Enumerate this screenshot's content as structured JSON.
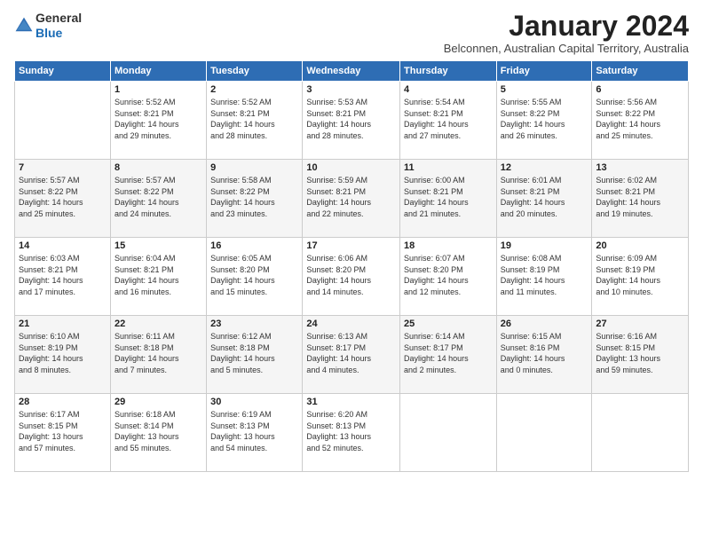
{
  "logo": {
    "line1": "General",
    "line2": "Blue"
  },
  "title": "January 2024",
  "subtitle": "Belconnen, Australian Capital Territory, Australia",
  "weekdays": [
    "Sunday",
    "Monday",
    "Tuesday",
    "Wednesday",
    "Thursday",
    "Friday",
    "Saturday"
  ],
  "weeks": [
    [
      {
        "day": "",
        "info": ""
      },
      {
        "day": "1",
        "info": "Sunrise: 5:52 AM\nSunset: 8:21 PM\nDaylight: 14 hours\nand 29 minutes."
      },
      {
        "day": "2",
        "info": "Sunrise: 5:52 AM\nSunset: 8:21 PM\nDaylight: 14 hours\nand 28 minutes."
      },
      {
        "day": "3",
        "info": "Sunrise: 5:53 AM\nSunset: 8:21 PM\nDaylight: 14 hours\nand 28 minutes."
      },
      {
        "day": "4",
        "info": "Sunrise: 5:54 AM\nSunset: 8:21 PM\nDaylight: 14 hours\nand 27 minutes."
      },
      {
        "day": "5",
        "info": "Sunrise: 5:55 AM\nSunset: 8:22 PM\nDaylight: 14 hours\nand 26 minutes."
      },
      {
        "day": "6",
        "info": "Sunrise: 5:56 AM\nSunset: 8:22 PM\nDaylight: 14 hours\nand 25 minutes."
      }
    ],
    [
      {
        "day": "7",
        "info": "Sunrise: 5:57 AM\nSunset: 8:22 PM\nDaylight: 14 hours\nand 25 minutes."
      },
      {
        "day": "8",
        "info": "Sunrise: 5:57 AM\nSunset: 8:22 PM\nDaylight: 14 hours\nand 24 minutes."
      },
      {
        "day": "9",
        "info": "Sunrise: 5:58 AM\nSunset: 8:22 PM\nDaylight: 14 hours\nand 23 minutes."
      },
      {
        "day": "10",
        "info": "Sunrise: 5:59 AM\nSunset: 8:21 PM\nDaylight: 14 hours\nand 22 minutes."
      },
      {
        "day": "11",
        "info": "Sunrise: 6:00 AM\nSunset: 8:21 PM\nDaylight: 14 hours\nand 21 minutes."
      },
      {
        "day": "12",
        "info": "Sunrise: 6:01 AM\nSunset: 8:21 PM\nDaylight: 14 hours\nand 20 minutes."
      },
      {
        "day": "13",
        "info": "Sunrise: 6:02 AM\nSunset: 8:21 PM\nDaylight: 14 hours\nand 19 minutes."
      }
    ],
    [
      {
        "day": "14",
        "info": "Sunrise: 6:03 AM\nSunset: 8:21 PM\nDaylight: 14 hours\nand 17 minutes."
      },
      {
        "day": "15",
        "info": "Sunrise: 6:04 AM\nSunset: 8:21 PM\nDaylight: 14 hours\nand 16 minutes."
      },
      {
        "day": "16",
        "info": "Sunrise: 6:05 AM\nSunset: 8:20 PM\nDaylight: 14 hours\nand 15 minutes."
      },
      {
        "day": "17",
        "info": "Sunrise: 6:06 AM\nSunset: 8:20 PM\nDaylight: 14 hours\nand 14 minutes."
      },
      {
        "day": "18",
        "info": "Sunrise: 6:07 AM\nSunset: 8:20 PM\nDaylight: 14 hours\nand 12 minutes."
      },
      {
        "day": "19",
        "info": "Sunrise: 6:08 AM\nSunset: 8:19 PM\nDaylight: 14 hours\nand 11 minutes."
      },
      {
        "day": "20",
        "info": "Sunrise: 6:09 AM\nSunset: 8:19 PM\nDaylight: 14 hours\nand 10 minutes."
      }
    ],
    [
      {
        "day": "21",
        "info": "Sunrise: 6:10 AM\nSunset: 8:19 PM\nDaylight: 14 hours\nand 8 minutes."
      },
      {
        "day": "22",
        "info": "Sunrise: 6:11 AM\nSunset: 8:18 PM\nDaylight: 14 hours\nand 7 minutes."
      },
      {
        "day": "23",
        "info": "Sunrise: 6:12 AM\nSunset: 8:18 PM\nDaylight: 14 hours\nand 5 minutes."
      },
      {
        "day": "24",
        "info": "Sunrise: 6:13 AM\nSunset: 8:17 PM\nDaylight: 14 hours\nand 4 minutes."
      },
      {
        "day": "25",
        "info": "Sunrise: 6:14 AM\nSunset: 8:17 PM\nDaylight: 14 hours\nand 2 minutes."
      },
      {
        "day": "26",
        "info": "Sunrise: 6:15 AM\nSunset: 8:16 PM\nDaylight: 14 hours\nand 0 minutes."
      },
      {
        "day": "27",
        "info": "Sunrise: 6:16 AM\nSunset: 8:15 PM\nDaylight: 13 hours\nand 59 minutes."
      }
    ],
    [
      {
        "day": "28",
        "info": "Sunrise: 6:17 AM\nSunset: 8:15 PM\nDaylight: 13 hours\nand 57 minutes."
      },
      {
        "day": "29",
        "info": "Sunrise: 6:18 AM\nSunset: 8:14 PM\nDaylight: 13 hours\nand 55 minutes."
      },
      {
        "day": "30",
        "info": "Sunrise: 6:19 AM\nSunset: 8:13 PM\nDaylight: 13 hours\nand 54 minutes."
      },
      {
        "day": "31",
        "info": "Sunrise: 6:20 AM\nSunset: 8:13 PM\nDaylight: 13 hours\nand 52 minutes."
      },
      {
        "day": "",
        "info": ""
      },
      {
        "day": "",
        "info": ""
      },
      {
        "day": "",
        "info": ""
      }
    ]
  ]
}
